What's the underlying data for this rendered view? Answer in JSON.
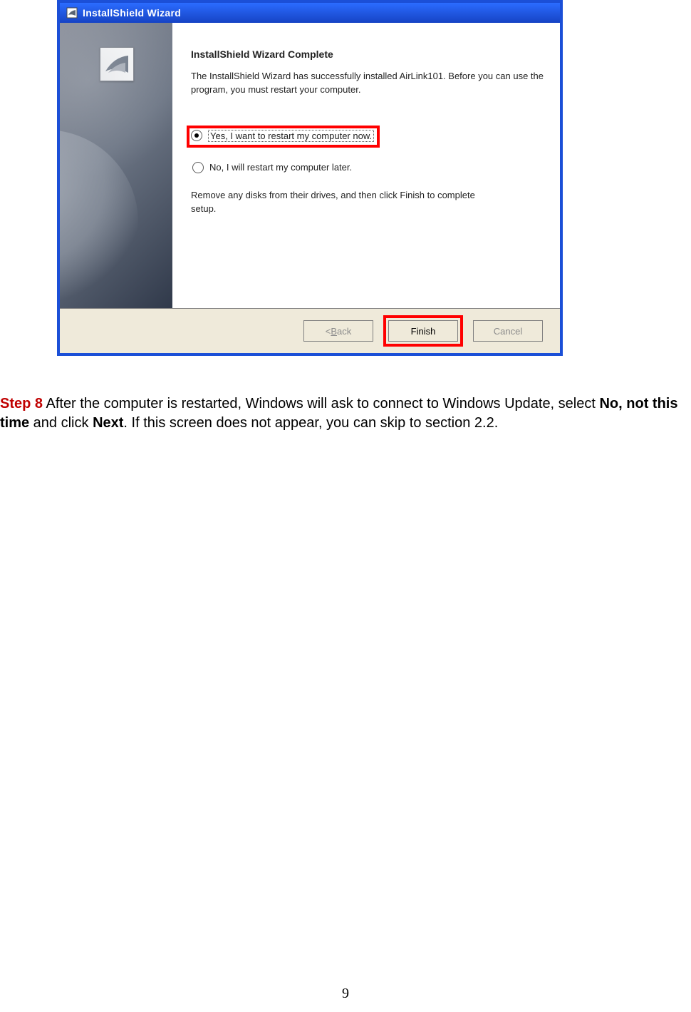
{
  "window": {
    "title": "InstallShield Wizard",
    "heading": "InstallShield Wizard Complete",
    "description": "The InstallShield Wizard has successfully installed AirLink101. Before you can use the program, you must restart your computer.",
    "radio_yes": "Yes, I want to restart my computer now.",
    "radio_no": "No, I will restart my computer later.",
    "note": "Remove any disks from their drives, and then click Finish to complete setup.",
    "back_prefix": "< ",
    "back_letter": "B",
    "back_rest": "ack",
    "finish": "Finish",
    "cancel": "Cancel"
  },
  "instruction": {
    "step": "Step 8",
    "t1": " After the computer is restarted, Windows will ask to connect to Windows Update, select ",
    "b1": "No, not this time",
    "t2": " and click ",
    "b2": "Next",
    "t3": ". If this screen does not appear, you can skip to section 2.2."
  },
  "page_number": "9"
}
